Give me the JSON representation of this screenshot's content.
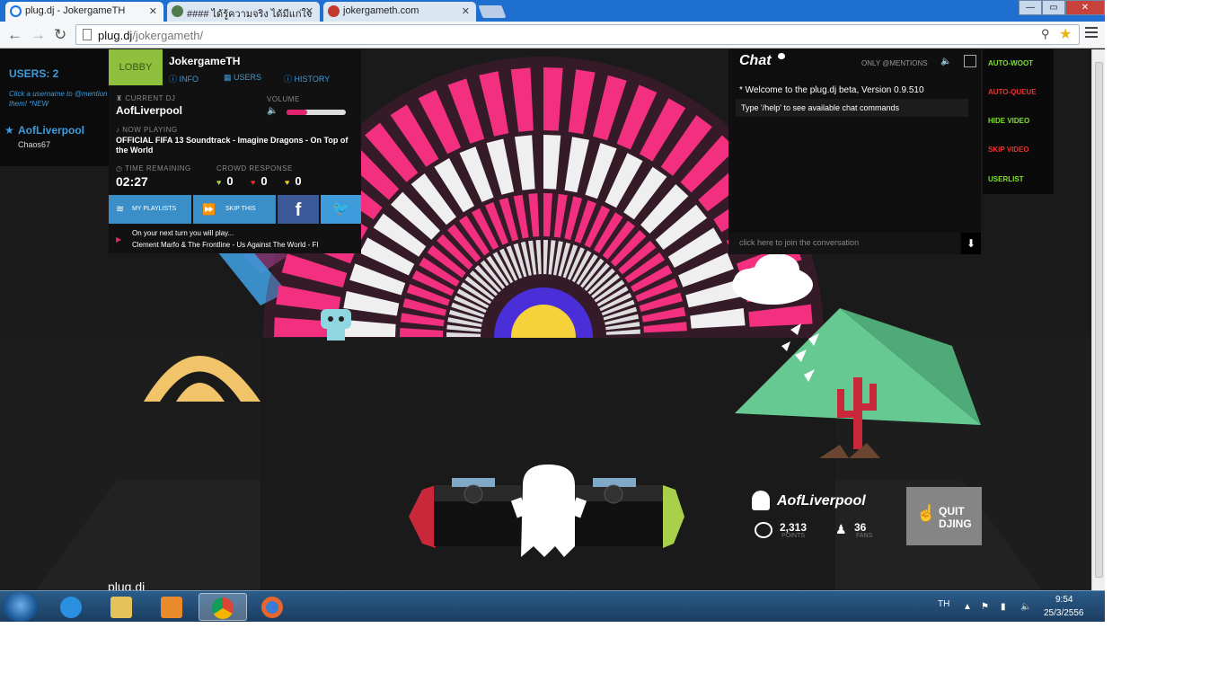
{
  "browser": {
    "tabs": [
      {
        "title": "plug.dj - JokergameTH",
        "icon_color": "#1a73e8"
      },
      {
        "title": "#### ได้รู้ความจริง ได้มีแก่ใจ",
        "icon_color": "#4f7b4f"
      },
      {
        "title": "jokergameth.com",
        "icon_color": "#c0392b"
      }
    ],
    "url_host": "plug.dj",
    "url_path": "/jokergameth/",
    "window_buttons": {
      "minimize": "—",
      "maximize": "▭",
      "close": "✕"
    }
  },
  "users_panel": {
    "count_label": "USERS: 2",
    "hint": "Click a username to @mention them! *NEW",
    "user_name": "AofLiverpool",
    "user_sub": "Chaos67"
  },
  "room": {
    "lobby_label": "LOBBY",
    "name": "JokergameTH",
    "links": [
      "INFO",
      "USERS",
      "HISTORY"
    ],
    "current_dj_label": "CURRENT DJ",
    "current_dj": "AofLiverpool",
    "volume_label": "VOLUME",
    "volume_level": 0.35,
    "now_playing_label": "NOW PLAYING",
    "track": "OFFICIAL FIFA 13 Soundtrack - Imagine Dragons - On Top of the World",
    "time_label": "TIME REMAINING",
    "time": "02:27",
    "crowd_label": "CROWD RESPONSE",
    "woots": "0",
    "mehs": "0",
    "curates": "0",
    "btn_playlists": "MY PLAYLISTS",
    "btn_skip": "SKIP THIS",
    "btn_fb": "f",
    "btn_tw": "🐦",
    "next_label": "On your next turn you will play...",
    "next_track": "Clement Marfo & The Frontline - Us Against The World - FI"
  },
  "chat": {
    "title": "Chat",
    "mentions": "ONLY @MENTIONS",
    "messages": [
      "* Welcome to the plug.dj beta, Version 0.9.510",
      "Type '/help' to see available chat commands"
    ],
    "input_placeholder": "click here to join the conversation",
    "send": "⬇"
  },
  "side_buttons": [
    {
      "label": "AUTO-WOOT",
      "color": "#7ee02b"
    },
    {
      "label": "AUTO-QUEUE",
      "color": "#e83333"
    },
    {
      "label": "HIDE VIDEO",
      "color": "#7ee02b"
    },
    {
      "label": "SKIP VIDEO",
      "color": "#e83333"
    },
    {
      "label": "USERLIST",
      "color": "#7ee02b"
    }
  ],
  "booth": {
    "dj_name": "AofLiverpool",
    "points": "2,313",
    "points_label": "POINTS",
    "fans": "36",
    "fans_label": "FANS",
    "quit_label_1": "QUIT",
    "quit_label_2": "DJING"
  },
  "footer": {
    "logo": "plug.dj"
  },
  "taskbar": {
    "lang": "TH",
    "time": "9:54",
    "date": "25/3/2556",
    "apps": [
      "internet-explorer",
      "file-explorer",
      "media-player",
      "chrome",
      "firefox"
    ]
  },
  "colors": {
    "accent_blue": "#3e9bdc",
    "pink": "#e0236f",
    "lobby_green": "#8ec03e"
  }
}
